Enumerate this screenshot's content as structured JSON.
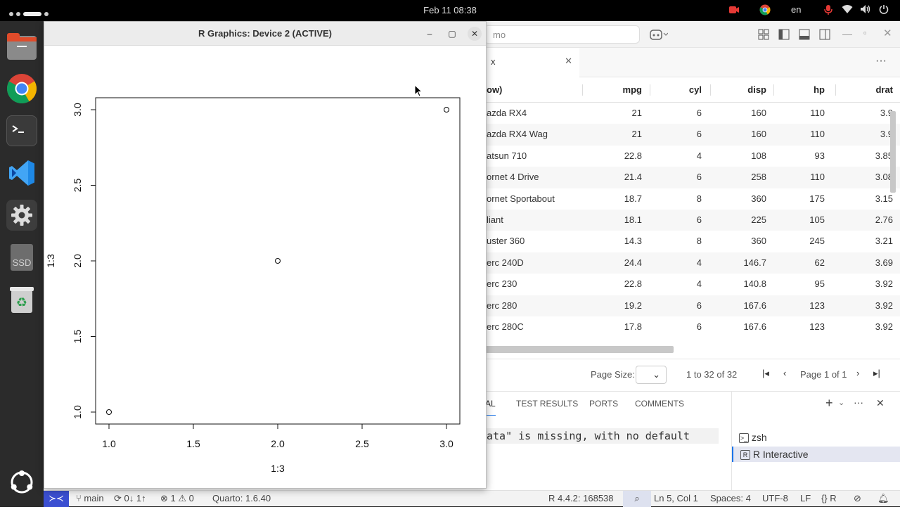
{
  "topbar": {
    "datetime": "Feb 11  08:38",
    "lang": "en"
  },
  "dock": {
    "ssd_label": "SSD"
  },
  "vscode": {
    "search_text": "mo",
    "tab_label": "x",
    "table": {
      "columns": [
        "ow)",
        "mpg",
        "cyl",
        "disp",
        "hp",
        "drat"
      ],
      "rows": [
        [
          "azda RX4",
          "21",
          "6",
          "160",
          "110",
          "3.9"
        ],
        [
          "azda RX4 Wag",
          "21",
          "6",
          "160",
          "110",
          "3.9"
        ],
        [
          "atsun 710",
          "22.8",
          "4",
          "108",
          "93",
          "3.85"
        ],
        [
          "ornet 4 Drive",
          "21.4",
          "6",
          "258",
          "110",
          "3.08"
        ],
        [
          "ornet Sportabout",
          "18.7",
          "8",
          "360",
          "175",
          "3.15"
        ],
        [
          "liant",
          "18.1",
          "6",
          "225",
          "105",
          "2.76"
        ],
        [
          "uster 360",
          "14.3",
          "8",
          "360",
          "245",
          "3.21"
        ],
        [
          "erc 240D",
          "24.4",
          "4",
          "146.7",
          "62",
          "3.69"
        ],
        [
          "erc 230",
          "22.8",
          "4",
          "140.8",
          "95",
          "3.92"
        ],
        [
          "erc 280",
          "19.2",
          "6",
          "167.6",
          "123",
          "3.92"
        ],
        [
          "erc 280C",
          "17.8",
          "6",
          "167.6",
          "123",
          "3.92"
        ]
      ]
    },
    "pager": {
      "page_size_label": "Page Size:",
      "range": "1 to 32 of 32",
      "page_label": "Page 1 of 1"
    },
    "panel": {
      "tabs": [
        "AL",
        "TEST RESULTS",
        "PORTS",
        "COMMENTS"
      ],
      "terminal_text": "ata\" is missing, with no default",
      "terminals": [
        "zsh",
        "R Interactive"
      ]
    },
    "status": {
      "branch": "main",
      "sync": "0↓ 1↑",
      "errors": "1",
      "warnings": "0",
      "quarto": "Quarto: 1.6.40",
      "r_version": "R 4.4.2: 168538",
      "position": "Ln 5, Col 1",
      "spaces": "Spaces: 4",
      "encoding": "UTF-8",
      "eol": "LF",
      "language": "R"
    }
  },
  "rwindow": {
    "title": "R Graphics: Device 2 (ACTIVE)",
    "chart_data": {
      "type": "scatter",
      "x": [
        1,
        2,
        3
      ],
      "y": [
        1,
        2,
        3
      ],
      "xlabel": "1:3",
      "ylabel": "1:3",
      "xlim": [
        1,
        3
      ],
      "ylim": [
        1,
        3
      ],
      "xticks": [
        "1.0",
        "1.5",
        "2.0",
        "2.5",
        "3.0"
      ],
      "yticks": [
        "1.0",
        "1.5",
        "2.0",
        "2.5",
        "3.0"
      ],
      "marker": "open-circle",
      "grid": false
    }
  }
}
